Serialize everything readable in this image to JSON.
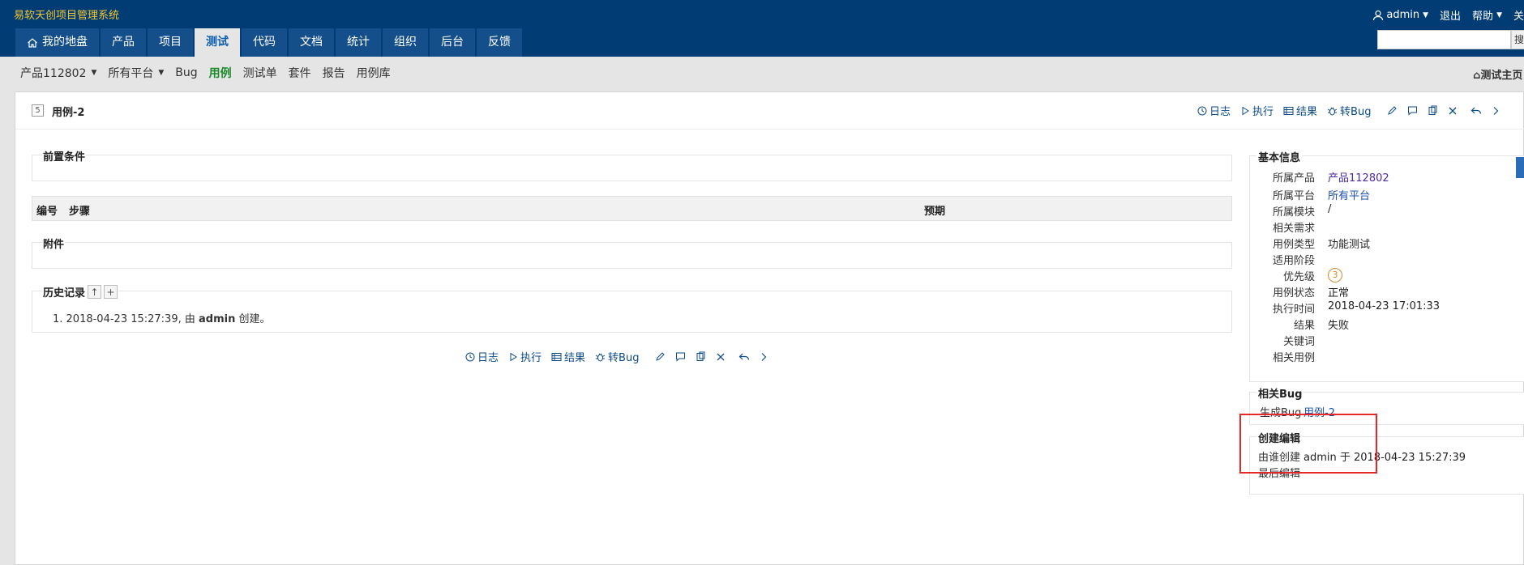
{
  "app": {
    "title": "易软天创项目管理系统",
    "user": "admin",
    "logout": "退出",
    "help": "帮助",
    "close_partial": "关",
    "search_placeholder": "",
    "search_btn": "搜"
  },
  "nav": {
    "tabs": [
      {
        "label": "我的地盘"
      },
      {
        "label": "产品"
      },
      {
        "label": "项目"
      },
      {
        "label": "测试"
      },
      {
        "label": "代码"
      },
      {
        "label": "文档"
      },
      {
        "label": "统计"
      },
      {
        "label": "组织"
      },
      {
        "label": "后台"
      },
      {
        "label": "反馈"
      }
    ]
  },
  "subnav": {
    "product": "产品112802",
    "platform": "所有平台",
    "items": [
      {
        "label": "Bug"
      },
      {
        "label": "用例"
      },
      {
        "label": "测试单"
      },
      {
        "label": "套件"
      },
      {
        "label": "报告"
      },
      {
        "label": "用例库"
      }
    ],
    "test_home": "测试主页"
  },
  "case": {
    "id": "5",
    "title": "用例-2",
    "actions": {
      "log": "日志",
      "run": "执行",
      "result": "结果",
      "to_bug": "转Bug"
    },
    "precondition_label": "前置条件",
    "steps_table": {
      "col_no": "编号",
      "col_step": "步骤",
      "col_expect": "预期"
    },
    "attach_label": "附件",
    "history": {
      "label": "历史记录",
      "entry_prefix": "1. 2018-04-23 15:27:39, 由",
      "entry_user": "admin",
      "entry_suffix": "创建。"
    }
  },
  "basic_info": {
    "label": "基本信息",
    "rows": [
      {
        "key": "所属产品",
        "value": "产品112802"
      },
      {
        "key": "所属平台",
        "value": "所有平台"
      },
      {
        "key": "所属模块",
        "value": "/"
      },
      {
        "key": "相关需求",
        "value": ""
      },
      {
        "key": "用例类型",
        "value": "功能测试"
      },
      {
        "key": "适用阶段",
        "value": ""
      },
      {
        "key": "优先级",
        "value": "3"
      },
      {
        "key": "用例状态",
        "value": "正常"
      },
      {
        "key": "执行时间",
        "value": "2018-04-23 17:01:33"
      },
      {
        "key": "结果",
        "value": "失败"
      },
      {
        "key": "关键词",
        "value": ""
      },
      {
        "key": "相关用例",
        "value": ""
      }
    ]
  },
  "related_bug": {
    "label": "相关Bug",
    "key": "生成Bug",
    "value": "用例-2"
  },
  "create_edit": {
    "label": "创建编辑",
    "created_key": "由谁创建",
    "created_value": "admin 于 2018-04-23 15:27:39",
    "edited_key": "最后编辑",
    "edited_value": ""
  },
  "colors": {
    "header_bg": "#023c74",
    "accent": "#0c5eb0",
    "highlight": "#e8272c"
  }
}
